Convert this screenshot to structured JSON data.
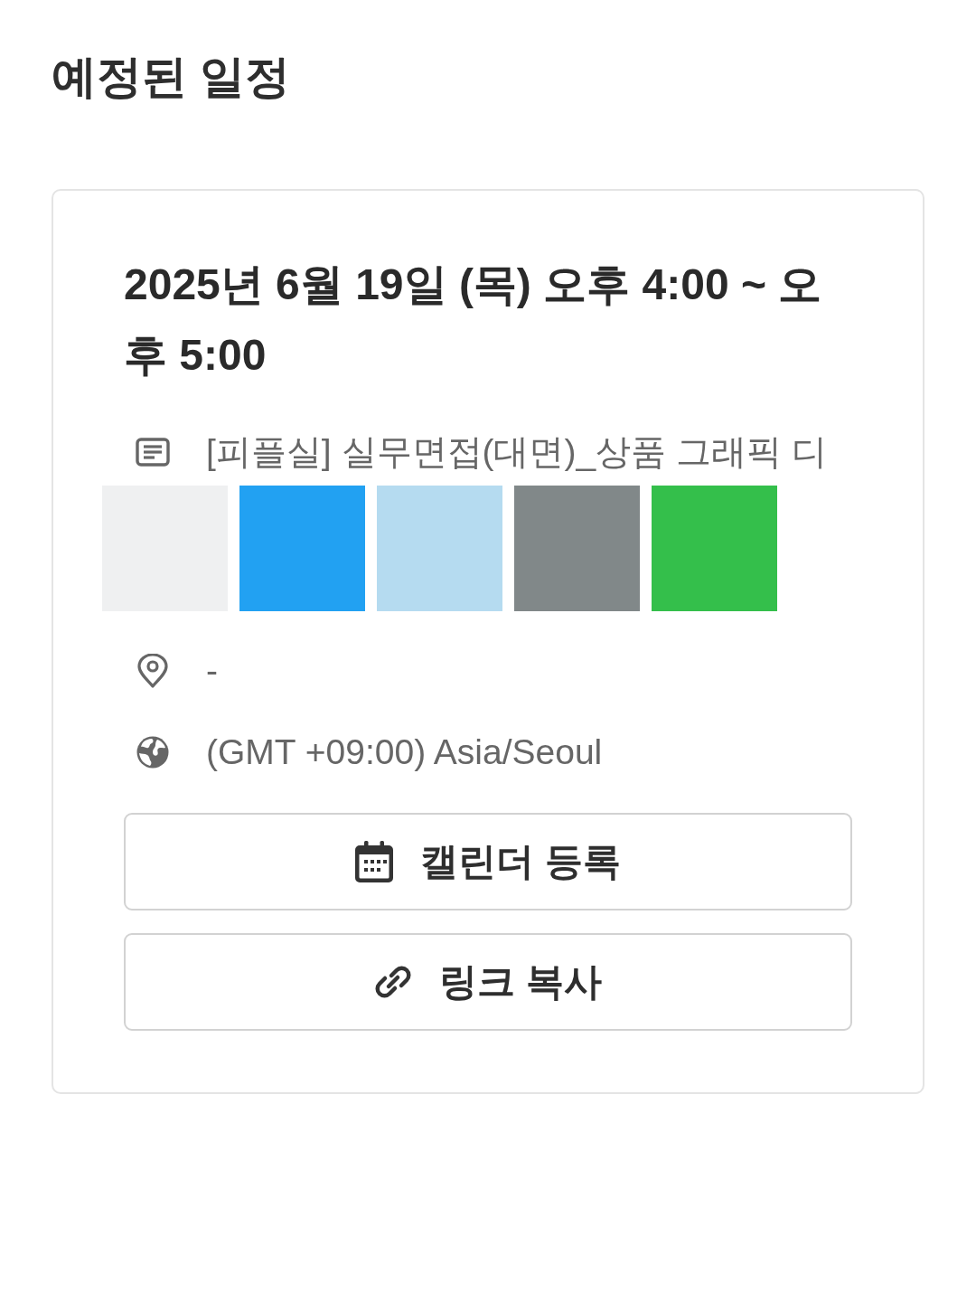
{
  "page": {
    "title": "예정된 일정"
  },
  "event": {
    "datetime": "2025년 6월 19일 (목) 오후 4:00 ~ 오후 5:00",
    "details": [
      {
        "kind": "title",
        "text": "[피플실] 실무면접(대면)_상품 그래픽 디",
        "swatches": [
          {
            "color": "#eff0f1"
          },
          {
            "color": "#22a1f2"
          },
          {
            "color": "#b5dbf0"
          },
          {
            "color": "#818889"
          },
          {
            "color": "#34bf4b"
          }
        ]
      },
      {
        "kind": "location",
        "text": "-"
      },
      {
        "kind": "timezone",
        "text": "(GMT +09:00) Asia/Seoul"
      }
    ],
    "buttons": [
      {
        "kind": "calendar",
        "label": "캘린더 등록"
      },
      {
        "kind": "link",
        "label": "링크 복사"
      }
    ]
  }
}
